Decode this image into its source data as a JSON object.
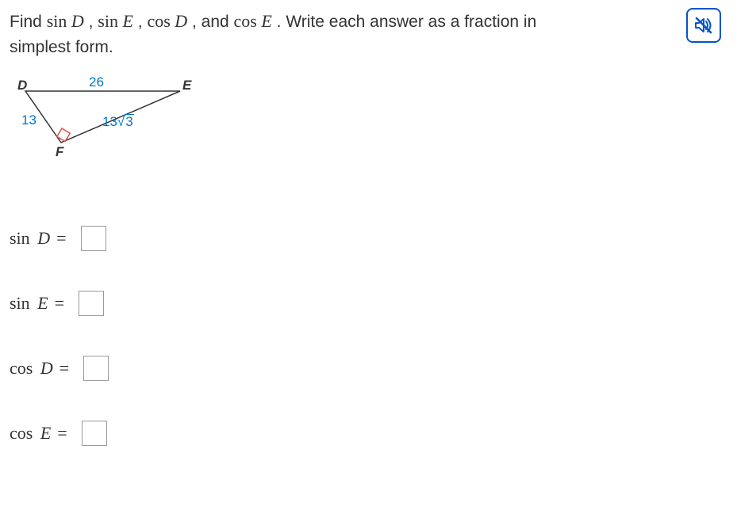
{
  "prompt": {
    "part1": "Find ",
    "fn_sin": "sin ",
    "fn_cos": "cos ",
    "varD": "D",
    "varE": "E",
    "sep": " , ",
    "and": " , and ",
    "part2": " . Write each answer as a fraction in simplest form."
  },
  "triangle": {
    "labelD": "D",
    "labelE": "E",
    "labelF": "F",
    "sideDE": "26",
    "sideDF": "13",
    "sideEF_coef": "13",
    "sideEF_rad": "3"
  },
  "answers": {
    "sinD": {
      "fn": "sin",
      "var": "D"
    },
    "sinE": {
      "fn": "sin",
      "var": "E"
    },
    "cosD": {
      "fn": "cos",
      "var": "D"
    },
    "cosE": {
      "fn": "cos",
      "var": "E"
    }
  },
  "eq": "="
}
